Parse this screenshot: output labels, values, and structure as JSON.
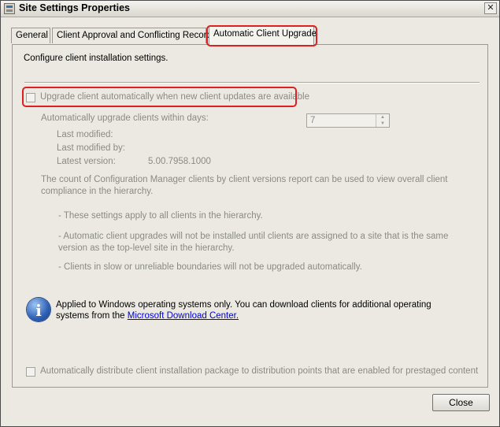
{
  "window": {
    "title": "Site Settings Properties",
    "close_glyph": "✕"
  },
  "tabs": [
    {
      "label": "General"
    },
    {
      "label": "Client Approval and Conflicting Records"
    },
    {
      "label": "Automatic Client Upgrade",
      "active": true
    }
  ],
  "panel": {
    "intro": "Configure client installation settings.",
    "upgrade_checkbox_label": "Upgrade client automatically when new client updates are available",
    "upgrade_checkbox_checked": false,
    "days_label": "Automatically upgrade clients within days:",
    "days_value": "7",
    "last_modified_label": "Last modified:",
    "last_modified_by_label": "Last modified by:",
    "latest_version_label": "Latest version:",
    "latest_version_value": "5.00.7958.1000",
    "report_note": "The count of Configuration Manager clients by client versions report can be used to view overall client compliance in the hierarchy.",
    "note_1": "- These settings apply to all clients in the hierarchy.",
    "note_2": "- Automatic client upgrades will not be installed until clients are assigned to a site that is the same version as the top-level site in the hierarchy.",
    "note_3": "- Clients in slow or unreliable boundaries will not be upgraded automatically.",
    "info_text": "Applied to Windows operating systems only. You can download clients for additional operating systems from the",
    "info_link": "Microsoft Download Center.",
    "distribute_checkbox_label": "Automatically distribute client installation package to distribution points that are enabled for prestaged content",
    "distribute_checkbox_checked": false
  },
  "buttons": {
    "close": "Close"
  },
  "colors": {
    "highlight": "#e02020",
    "disabled_text": "#8b8a85",
    "link": "#0000e0"
  }
}
